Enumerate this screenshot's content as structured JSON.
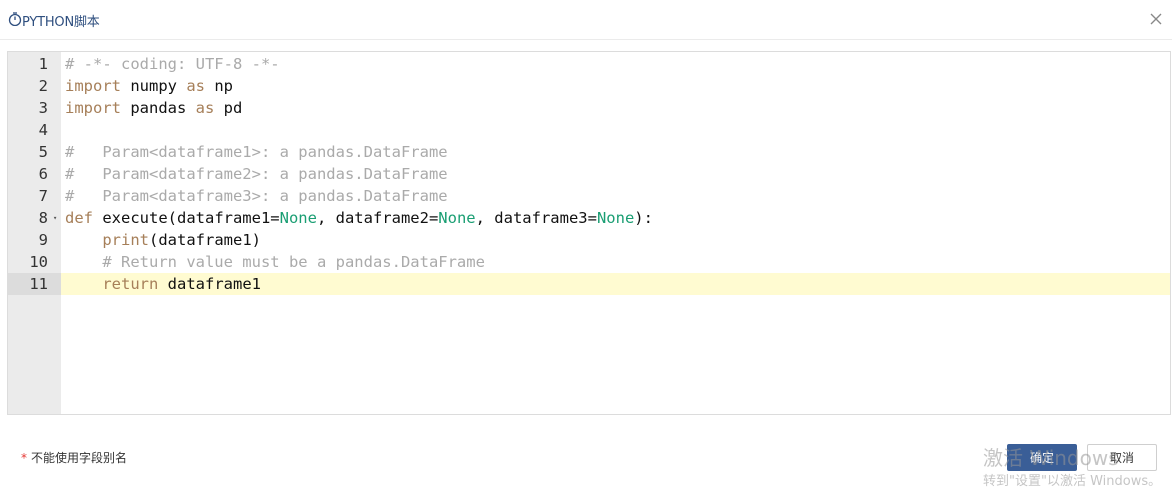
{
  "dialog": {
    "title": "PYTHON脚本",
    "title_icon": "timer-icon",
    "close_icon": "close-icon"
  },
  "editor": {
    "active_line": 11,
    "lines": [
      {
        "num": "1",
        "fold": "",
        "tokens": [
          {
            "t": "# -*- coding: UTF-8 -*-",
            "c": "cmt"
          }
        ]
      },
      {
        "num": "2",
        "fold": "",
        "tokens": [
          {
            "t": "import",
            "c": "kw"
          },
          {
            "t": " numpy ",
            "c": ""
          },
          {
            "t": "as",
            "c": "kw"
          },
          {
            "t": " np",
            "c": ""
          }
        ]
      },
      {
        "num": "3",
        "fold": "",
        "tokens": [
          {
            "t": "import",
            "c": "kw"
          },
          {
            "t": " pandas ",
            "c": ""
          },
          {
            "t": "as",
            "c": "kw"
          },
          {
            "t": " pd",
            "c": ""
          }
        ]
      },
      {
        "num": "4",
        "fold": "",
        "tokens": []
      },
      {
        "num": "5",
        "fold": "",
        "tokens": [
          {
            "t": "#   Param<dataframe1>: a pandas.DataFrame",
            "c": "cmt"
          }
        ]
      },
      {
        "num": "6",
        "fold": "",
        "tokens": [
          {
            "t": "#   Param<dataframe2>: a pandas.DataFrame",
            "c": "cmt"
          }
        ]
      },
      {
        "num": "7",
        "fold": "",
        "tokens": [
          {
            "t": "#   Param<dataframe3>: a pandas.DataFrame",
            "c": "cmt"
          }
        ]
      },
      {
        "num": "8",
        "fold": "▾",
        "tokens": [
          {
            "t": "def",
            "c": "kw"
          },
          {
            "t": " execute(dataframe1=",
            "c": ""
          },
          {
            "t": "None",
            "c": "const"
          },
          {
            "t": ", dataframe2=",
            "c": ""
          },
          {
            "t": "None",
            "c": "const"
          },
          {
            "t": ", dataframe3=",
            "c": ""
          },
          {
            "t": "None",
            "c": "const"
          },
          {
            "t": "):",
            "c": ""
          }
        ]
      },
      {
        "num": "9",
        "fold": "",
        "tokens": [
          {
            "t": "    ",
            "c": ""
          },
          {
            "t": "print",
            "c": "fn"
          },
          {
            "t": "(dataframe1)",
            "c": ""
          }
        ]
      },
      {
        "num": "10",
        "fold": "",
        "tokens": [
          {
            "t": "    ",
            "c": ""
          },
          {
            "t": "# Return value must be a pandas.DataFrame",
            "c": "cmt"
          }
        ]
      },
      {
        "num": "11",
        "fold": "",
        "tokens": [
          {
            "t": "    ",
            "c": ""
          },
          {
            "t": "return",
            "c": "kw"
          },
          {
            "t": " dataframe1",
            "c": ""
          }
        ]
      }
    ]
  },
  "footer": {
    "required_mark": "*",
    "note": "不能使用字段别名",
    "ok_label": "确定",
    "cancel_label": "取消"
  },
  "overlay": {
    "watermark_line1": "激活 Windows",
    "watermark_line2": "转到\"设置\"以激活 Windows。"
  },
  "colors": {
    "primary_button": "#3a5e97",
    "active_line_bg": "#fffbd1",
    "keyword": "#a67f59",
    "constant": "#1a9e73",
    "comment": "#aaaaaa"
  }
}
